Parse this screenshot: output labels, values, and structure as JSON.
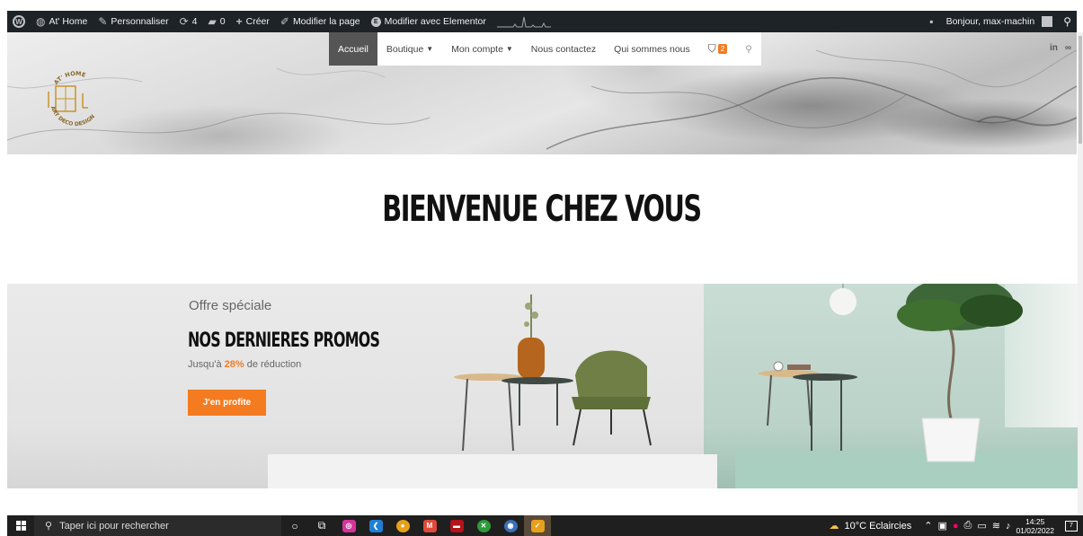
{
  "adminbar": {
    "site_name": "At' Home",
    "customize": "Personnaliser",
    "updates_count": "4",
    "comments_count": "0",
    "create": "Créer",
    "edit_page": "Modifier la page",
    "edit_elementor": "Modifier avec Elementor",
    "greeting": "Bonjour, max-machin"
  },
  "nav": {
    "items": [
      {
        "label": "Accueil"
      },
      {
        "label": "Boutique"
      },
      {
        "label": "Mon compte"
      },
      {
        "label": "Nous contactez"
      },
      {
        "label": "Qui sommes nous"
      }
    ],
    "cart_count": "2"
  },
  "logo": {
    "top_text": "AT' HOME",
    "bottom_text": "ART DECO DESIGN",
    "color": "#c8942b"
  },
  "socials": [
    "in",
    "∞"
  ],
  "welcome": {
    "title": "BIENVENUE CHEZ VOUS"
  },
  "promo": {
    "eyebrow": "Offre spéciale",
    "title": "NOS DERNIERES PROMOS",
    "subtitle_before": "Jusqu'à ",
    "percent": "28%",
    "subtitle_after": " de réduction",
    "cta": "J'en profite",
    "accent_color": "#f47b20"
  },
  "taskbar": {
    "search_placeholder": "Taper ici pour rechercher",
    "weather": "10°C  Eclaircies",
    "time": "14:25",
    "date": "01/02/2022",
    "notification_count": "7"
  }
}
